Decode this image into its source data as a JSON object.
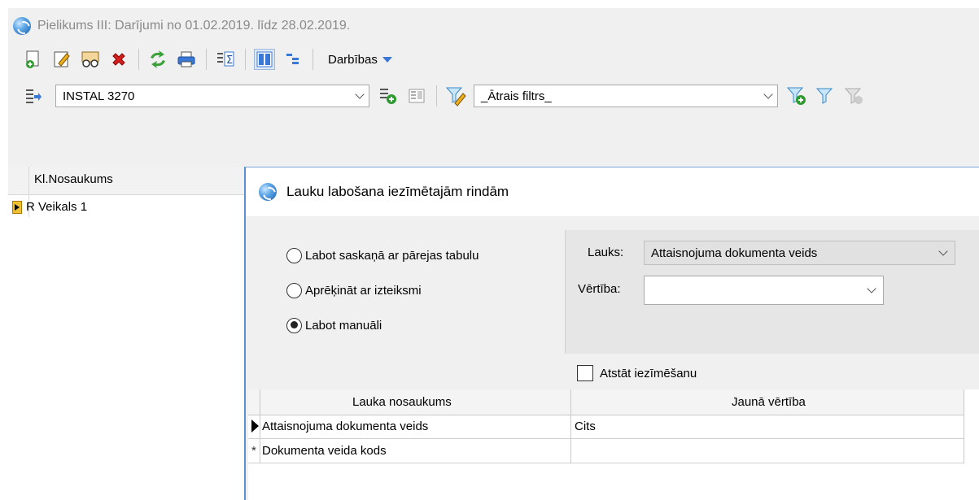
{
  "window": {
    "title": "Pielikums III: Darījumi no 01.02.2019. līdz 28.02.2019."
  },
  "toolbar": {
    "actions_label": "Darbības"
  },
  "filter_bar": {
    "object_value": "INSTAL 3270",
    "quick_filter_value": "_Ātrais filtrs_"
  },
  "left_grid": {
    "column_header": "Kl.Nosaukums",
    "rows": [
      {
        "name": "R Veikals 1"
      }
    ]
  },
  "dialog": {
    "title": "Lauku labošana iezīmētajām rindām",
    "options": [
      {
        "label": "Labot saskaņā ar pārejas tabulu",
        "selected": false
      },
      {
        "label": "Aprēķināt ar izteiksmi",
        "selected": false
      },
      {
        "label": "Labot manuāli",
        "selected": true
      }
    ],
    "field_label": "Lauks:",
    "field_value": "Attaisnojuma dokumenta veids",
    "value_label": "Vērtība:",
    "value_value": "",
    "keep_selection_label": "Atstāt iezīmēšanu",
    "keep_selection_checked": false,
    "grid": {
      "col_field": "Lauka nosaukums",
      "col_value": "Jaunā vērtība",
      "rows": [
        {
          "field": "Attaisnojuma dokumenta veids",
          "value": "Cits",
          "current": true
        },
        {
          "field": "Dokumenta veida kods",
          "value": "",
          "new": true
        }
      ]
    }
  },
  "colors": {
    "accent": "#3a78d8",
    "dialog_border": "#5a8fd0",
    "panel_bg": "#e6e6e6"
  }
}
